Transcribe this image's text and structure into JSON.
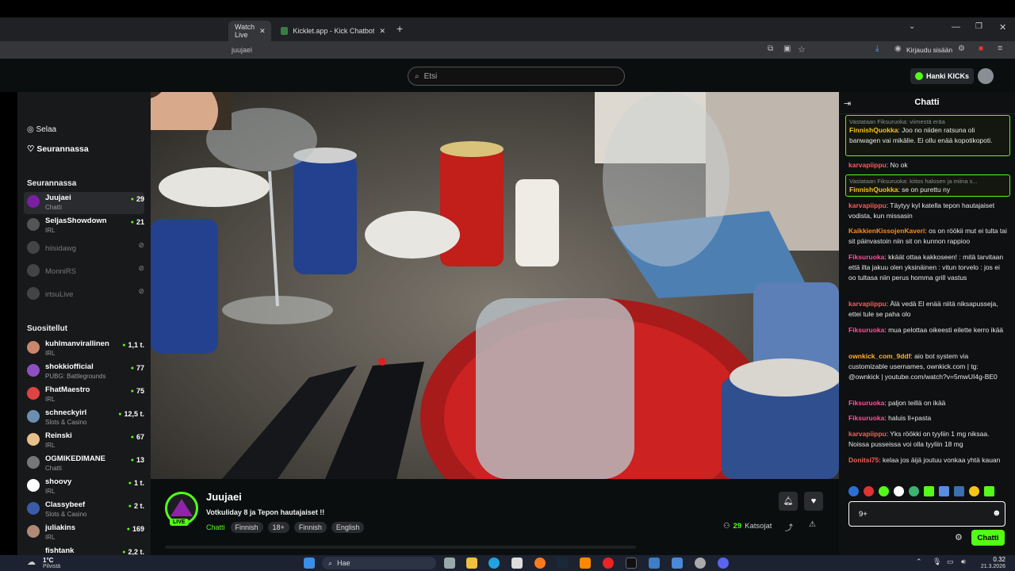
{
  "browser": {
    "tabs": [
      {
        "label": "Watch Live"
      },
      {
        "label": "Kicklet.app - Kick Chatbot and"
      }
    ],
    "address": "juujaei",
    "signin": "Kirjaudu sisään"
  },
  "header": {
    "search_placeholder": "Etsi",
    "get_kicks": "Hanki KICKs"
  },
  "sidebar": {
    "nav_browse": "Selaa",
    "nav_following": "Seurannassa",
    "following_title": "Seurannassa",
    "following": [
      {
        "name": "Juujaei",
        "category": "Chatti",
        "viewers": "29",
        "active": true
      },
      {
        "name": "SeljasShowdown",
        "category": "IRL",
        "viewers": "21"
      },
      {
        "name": "hiisidawg",
        "offline": true
      },
      {
        "name": "MonniRS",
        "offline": true
      },
      {
        "name": "irtsuLive",
        "offline": true
      }
    ],
    "recommended_title": "Suositellut",
    "recommended": [
      {
        "name": "kuhlmanvirallinen",
        "category": "IRL",
        "viewers": "1,1 t."
      },
      {
        "name": "shokkiofficial",
        "category": "PUBG: Battlegrounds",
        "viewers": "77"
      },
      {
        "name": "FhatMaestro",
        "category": "IRL",
        "viewers": "75"
      },
      {
        "name": "schneckyirl",
        "category": "Slots & Casino",
        "viewers": "12,5 t."
      },
      {
        "name": "Reinski",
        "category": "IRL",
        "viewers": "67"
      },
      {
        "name": "OGMIKEDIMANE",
        "category": "Chatti",
        "viewers": "13"
      },
      {
        "name": "shoovy",
        "category": "IRL",
        "viewers": "1 t."
      },
      {
        "name": "Classybeef",
        "category": "Slots & Casino",
        "viewers": "2 t."
      },
      {
        "name": "juliakins",
        "category": "IRL",
        "viewers": "169"
      },
      {
        "name": "fishtank",
        "category": "",
        "viewers": "2,2 t."
      }
    ]
  },
  "stream": {
    "channel": "Juujaei",
    "title": "Votkuliday 8 ja Tepon hautajaiset !!",
    "live_badge": "LIVE",
    "category": "Chatti",
    "tags": [
      "Finnish",
      "18+",
      "Finnish",
      "English"
    ],
    "viewer_count": "29",
    "viewer_label": "Katsojat"
  },
  "chat": {
    "title": "Chatti",
    "messages": [
      {
        "reply_to": "Vastataan Fiksuruoka: viimestä eräa",
        "user": "FinnishQuokka",
        "color": "#f5c518",
        "text": "Joo no niiden ratsuna oli banwagen vai mikälie. Ei ollu enää kopotikopoti.",
        "highlight": true
      },
      {
        "user": "karvapiippu",
        "color": "#ff5a5a",
        "text": "No ok"
      },
      {
        "reply_to": "Vastataan Fiksuruoka: kiitos halosen ja miina s...",
        "user": "FinnishQuokka",
        "color": "#f5c518",
        "text": "se on purettu ny",
        "highlight": true
      },
      {
        "user": "karvapiippu",
        "color": "#ff5a5a",
        "text": "Täytyy kyl katella tepon hautajaiset vodista, kun missasin"
      },
      {
        "user": "KaikkienKissojenKaveri",
        "color": "#ff8c1a",
        "text": "os on röökii mut ei tulta tai sit päinvastoin niin sit on kunnon rappioo"
      },
      {
        "user": "Fiksuruoka",
        "color": "#ff4fa0",
        "text": "kkäät ottaa kakkoseen! : mitä tarvitaan että ilta jakuu olen yksinäinen : vitun torvelo : jos ei oo tultasa niin perus homma grill vastus"
      },
      {
        "user": "karvapiippu",
        "color": "#ff5a5a",
        "text": "Älä vedä El enää niitä niksapusseja, ettei tule se paha olo"
      },
      {
        "user": "Fiksuruoka",
        "color": "#ff4fa0",
        "text": "mua pelottaa oikeesti eilette kerro ikää"
      },
      {
        "user": "ownkick_com_9ddf",
        "color": "#ffb02e",
        "text": "aio bot system via customizable usernames, ownkick.com | tg: @ownkick | youtube.com/watch?v=5mwUI4g-BE0"
      },
      {
        "user": "Fiksuruoka",
        "color": "#ff4fa0",
        "text": "paljon teillä on ikää"
      },
      {
        "user": "Fiksuruoka",
        "color": "#ff4fa0",
        "text": "haluis ll+pasta"
      },
      {
        "user": "karvapiippu",
        "color": "#ff5a5a",
        "text": "Yks röökki on tyyliin 1 mg niksaa. Noissa pusseissa voi olla tyyliin 18 mg"
      },
      {
        "user": "Donitsi75",
        "color": "#ff5a5a",
        "text": "kelaa jos äijä joutuu vonkaa yhtä kauan"
      }
    ],
    "input_value": "9+",
    "send_label": "Chatti"
  },
  "taskbar": {
    "weather_temp": "1°C",
    "weather_desc": "Pilvistä",
    "search": "Hae",
    "time": "0.32",
    "date": "21.3.2026"
  }
}
